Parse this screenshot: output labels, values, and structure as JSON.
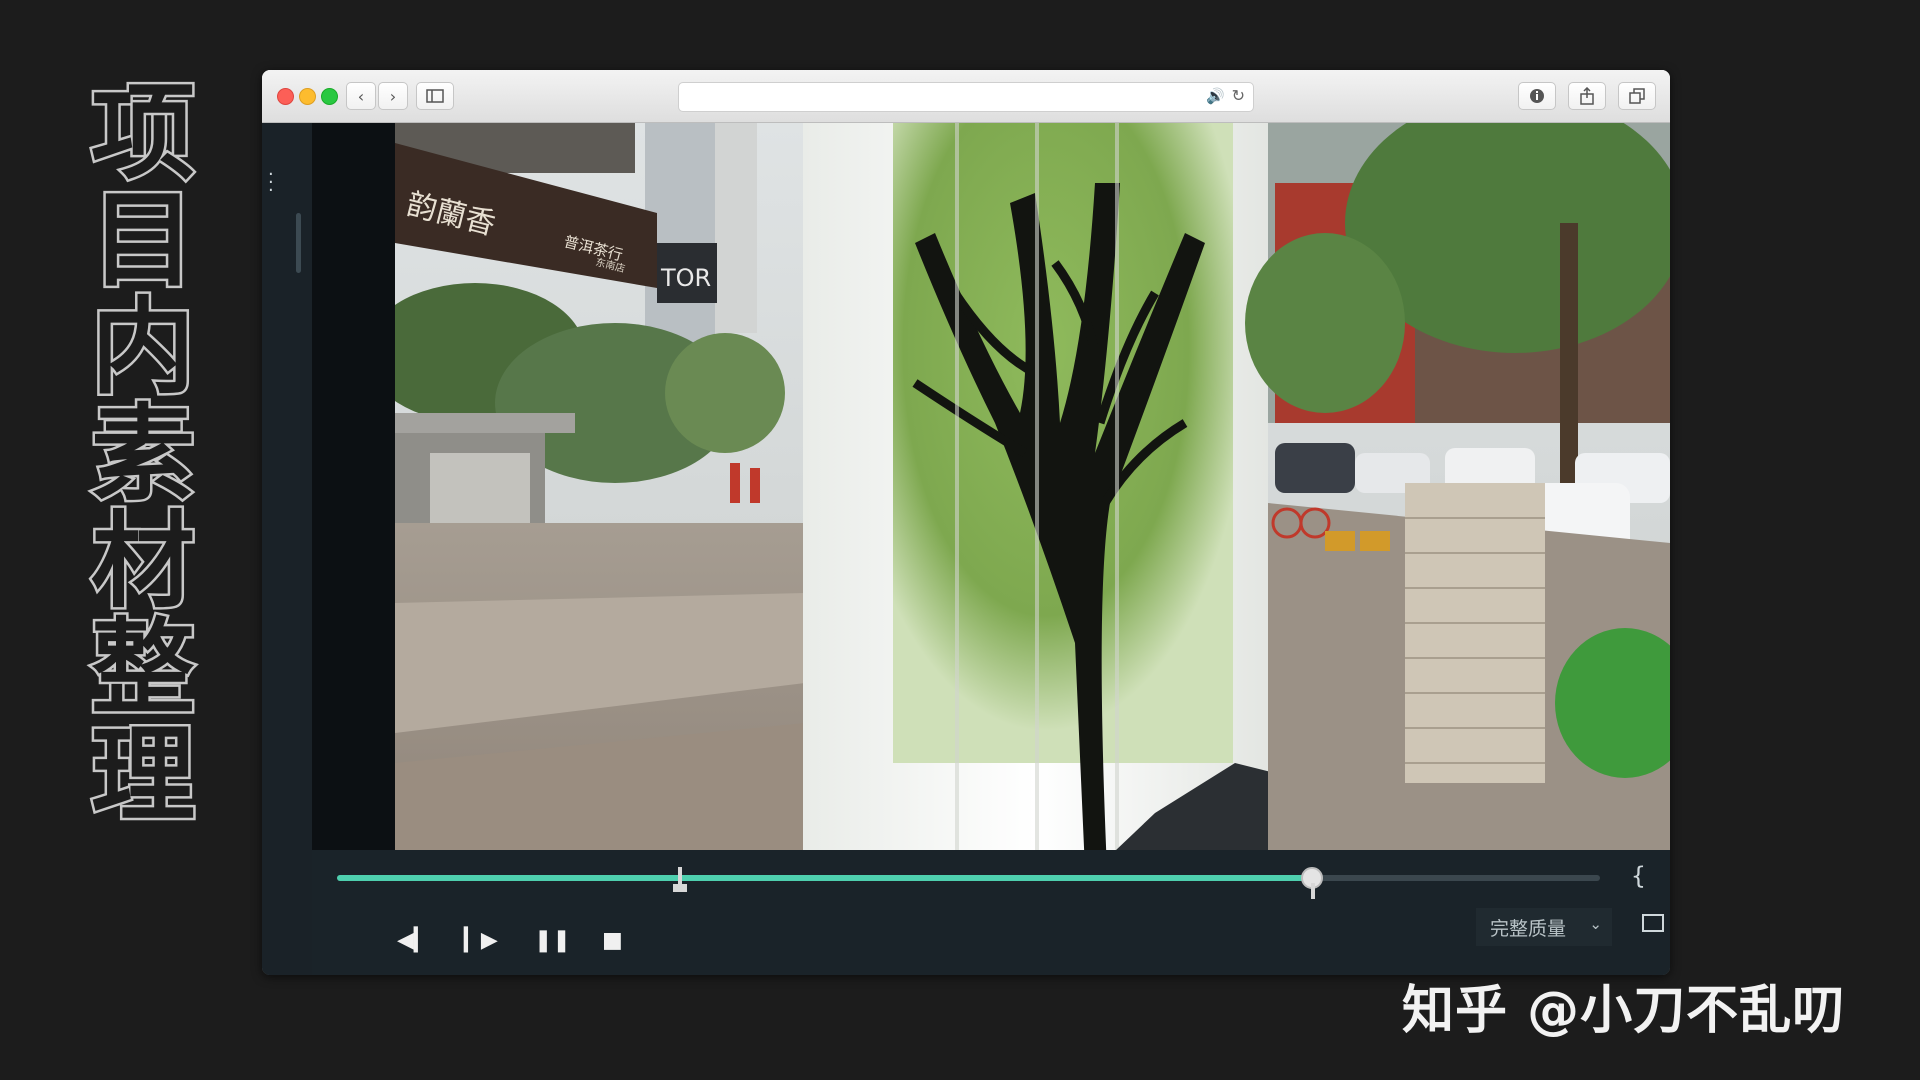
{
  "side_title": [
    "项",
    "目",
    "内",
    "素",
    "材",
    "整",
    "理"
  ],
  "browser": {
    "back_icon": "chevron-left-icon",
    "forward_icon": "chevron-right-icon",
    "sidebar_icon": "sidebar-icon",
    "address_bar": {
      "placeholder": "",
      "audio_icon": "speaker-icon",
      "reload_icon": "reload-icon"
    },
    "toolbar_right": [
      "info-icon",
      "share-icon",
      "tabs-icon"
    ]
  },
  "player": {
    "progress_fraction": 0.78,
    "in_point_fraction": 0.27,
    "playhead_fraction": 0.77,
    "brace_symbol": "{",
    "buttons": [
      "step-back-icon",
      "step-forward-icon",
      "pause-icon",
      "stop-icon"
    ],
    "quality_label": "完整质量",
    "fullscreen_icon": "monitor-icon"
  },
  "video_frame": {
    "shop_sign_text": "韵蘭香",
    "shop_sign_sub": "普洱茶行",
    "shop_sign_sub2": "东南店",
    "tor_text": "TOR"
  },
  "watermark": "知乎 @小刀不乱叨"
}
